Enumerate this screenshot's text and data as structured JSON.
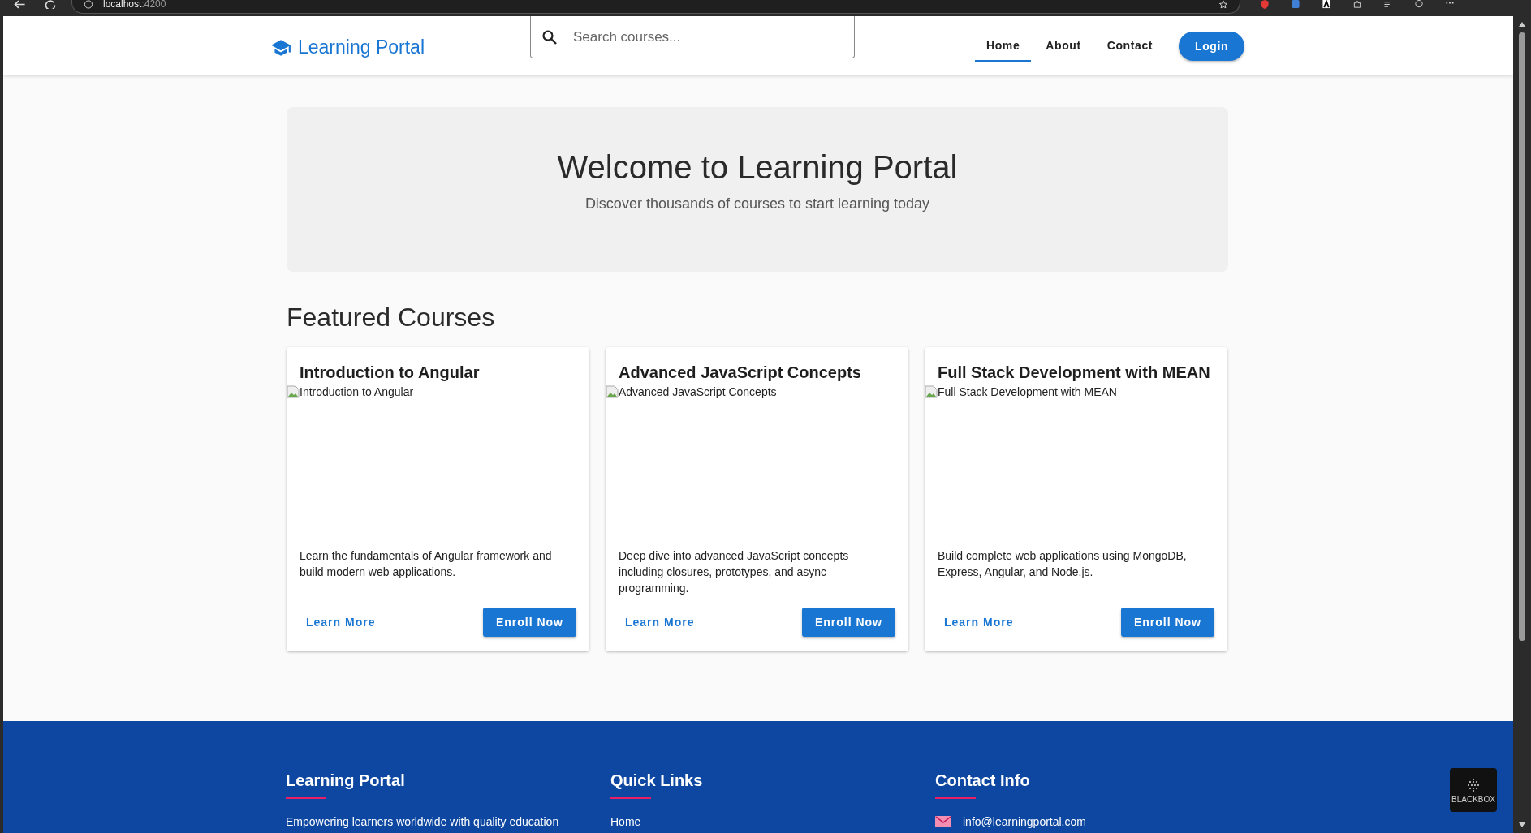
{
  "browser": {
    "address": "localhost",
    "port": ":4200"
  },
  "header": {
    "logo": "Learning Portal",
    "search": {
      "placeholder": "Search courses..."
    },
    "nav": [
      {
        "label": "Home",
        "selected": true
      },
      {
        "label": "About",
        "selected": false
      },
      {
        "label": "Contact",
        "selected": false
      }
    ],
    "login": "Login"
  },
  "hero": {
    "title": "Welcome to Learning Portal",
    "subtitle": "Discover thousands of courses to start learning today"
  },
  "featured": {
    "title": "Featured Courses",
    "courses": [
      {
        "title": "Introduction to Angular",
        "image_alt": "Introduction to Angular",
        "description": "Learn the fundamentals of Angular framework and build modern web applications.",
        "secondary": "Learn More",
        "primary": "Enroll Now"
      },
      {
        "title": "Advanced JavaScript Concepts",
        "image_alt": "Advanced JavaScript Concepts",
        "description": "Deep dive into advanced JavaScript concepts including closures, prototypes, and async programming.",
        "secondary": "Learn More",
        "primary": "Enroll Now"
      },
      {
        "title": "Full Stack Development with MEAN",
        "image_alt": "Full Stack Development with MEAN",
        "description": "Build complete web applications using MongoDB, Express, Angular, and Node.js.",
        "secondary": "Learn More",
        "primary": "Enroll Now"
      }
    ]
  },
  "footer": {
    "columns": [
      {
        "title": "Learning Portal",
        "kind": "text",
        "text": "Empowering learners worldwide with quality education"
      },
      {
        "title": "Quick Links",
        "kind": "link",
        "text": "Home"
      },
      {
        "title": "Contact Info",
        "kind": "email",
        "text": "info@learningportal.com"
      }
    ]
  },
  "widget": {
    "label": "BLACKBOX"
  }
}
